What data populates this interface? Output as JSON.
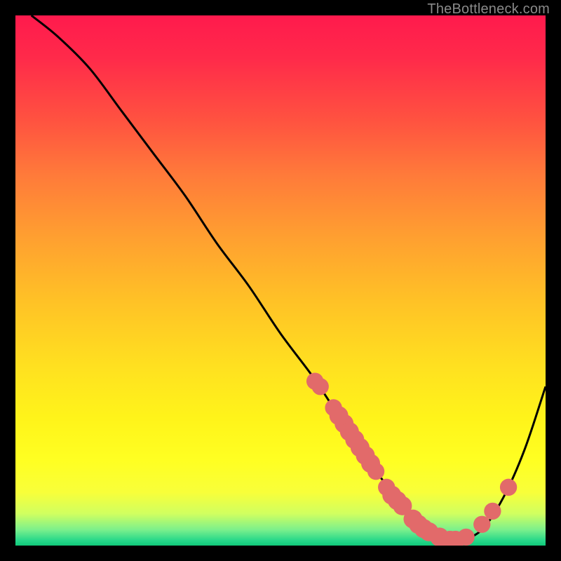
{
  "watermark": "TheBottleneck.com",
  "chart_data": {
    "type": "line",
    "title": "",
    "xlabel": "",
    "ylabel": "",
    "xlim": [
      0,
      100
    ],
    "ylim": [
      0,
      100
    ],
    "grid": false,
    "legend": false,
    "series": [
      {
        "name": "curve",
        "x": [
          3,
          8,
          14,
          20,
          26,
          32,
          38,
          44,
          50,
          56,
          60,
          64,
          68,
          72,
          75,
          78,
          81,
          84,
          88,
          92,
          96,
          100
        ],
        "y": [
          100,
          96,
          90,
          82,
          74,
          66,
          57,
          49,
          40,
          32,
          26,
          20,
          14,
          9,
          5,
          2.5,
          1,
          1,
          3,
          9,
          18,
          30
        ],
        "color": "#000000"
      }
    ],
    "markers": [
      {
        "x": 56.5,
        "y": 31,
        "r": 1.2
      },
      {
        "x": 57.5,
        "y": 30,
        "r": 1.2
      },
      {
        "x": 60,
        "y": 26,
        "r": 1.2
      },
      {
        "x": 61,
        "y": 24.5,
        "r": 1.4
      },
      {
        "x": 62,
        "y": 23,
        "r": 1.4
      },
      {
        "x": 63,
        "y": 21.5,
        "r": 1.4
      },
      {
        "x": 64,
        "y": 20,
        "r": 1.4
      },
      {
        "x": 65,
        "y": 18.5,
        "r": 1.4
      },
      {
        "x": 66,
        "y": 17,
        "r": 1.4
      },
      {
        "x": 67,
        "y": 15.5,
        "r": 1.4
      },
      {
        "x": 68,
        "y": 14,
        "r": 1.2
      },
      {
        "x": 70,
        "y": 11,
        "r": 1.2
      },
      {
        "x": 71,
        "y": 9.5,
        "r": 1.4
      },
      {
        "x": 72,
        "y": 8.5,
        "r": 1.4
      },
      {
        "x": 73,
        "y": 7.5,
        "r": 1.4
      },
      {
        "x": 75,
        "y": 5,
        "r": 1.4
      },
      {
        "x": 76,
        "y": 4,
        "r": 1.4
      },
      {
        "x": 77,
        "y": 3.2,
        "r": 1.4
      },
      {
        "x": 78,
        "y": 2.6,
        "r": 1.4
      },
      {
        "x": 80,
        "y": 1.6,
        "r": 1.4
      },
      {
        "x": 82,
        "y": 1.0,
        "r": 1.4
      },
      {
        "x": 83,
        "y": 1.0,
        "r": 1.4
      },
      {
        "x": 85,
        "y": 1.6,
        "r": 1.2
      },
      {
        "x": 88,
        "y": 4,
        "r": 1.2
      },
      {
        "x": 90,
        "y": 6.5,
        "r": 1.2
      },
      {
        "x": 93,
        "y": 11,
        "r": 1.2
      }
    ],
    "marker_color": "#e26a6a"
  }
}
